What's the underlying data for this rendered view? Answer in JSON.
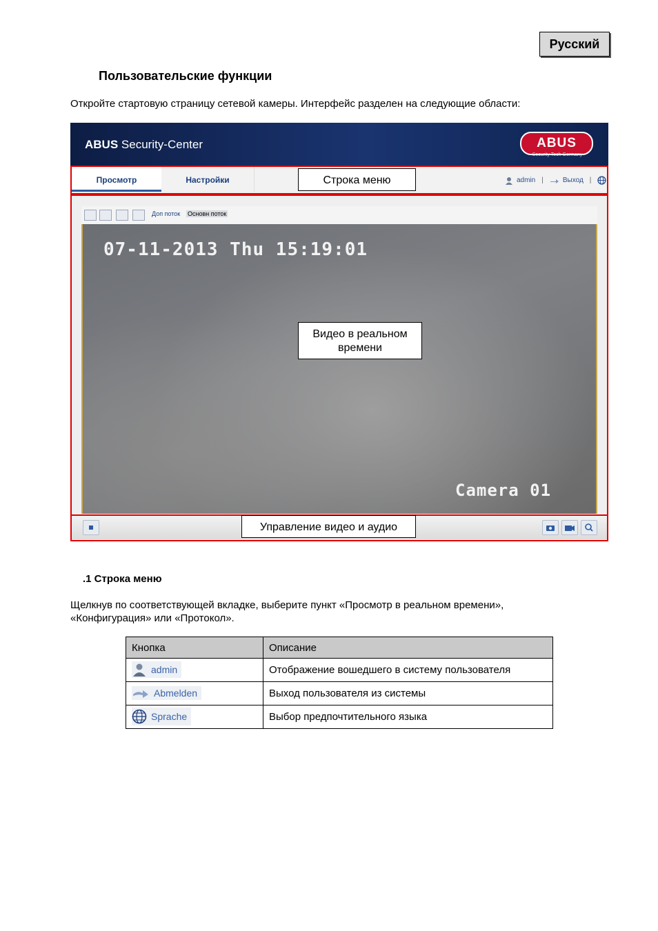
{
  "language_label": "Русский",
  "page_heading": "Пользовательские функции",
  "intro_text": "Откройте стартовую страницу сетевой камеры. Интерфейс разделен на следующие области:",
  "app": {
    "title_bold": "ABUS",
    "title_rest": " Security-Center",
    "logo_text": "ABUS",
    "logo_tagline": "Security Tech Germany",
    "tabs": [
      "Просмотр",
      "Настройки"
    ],
    "user": "admin",
    "logout": "Выход",
    "separator": "|",
    "streams": [
      "Доп поток",
      "Основн поток"
    ],
    "osd_timestamp": "07-11-2013 Thu 15:19:01",
    "osd_camera": "Camera 01"
  },
  "callouts": {
    "menu_bar": "Строка меню",
    "live_video": "Видео в реальном времени",
    "av_control": "Управление видео и аудио"
  },
  "section": {
    "heading": ".1 Строка меню",
    "paragraph": "Щелкнув по соответствующей вкладке, выберите пункт «Просмотр в реальном времени», «Конфигурация» или «Протокол»."
  },
  "table": {
    "headers": [
      "Кнопка",
      "Описание"
    ],
    "rows": [
      {
        "button": "admin",
        "icon": "user-icon",
        "description": "Отображение вошедшего в систему пользователя"
      },
      {
        "button": "Abmelden",
        "icon": "logout-icon",
        "description": "Выход пользователя из системы"
      },
      {
        "button": "Sprache",
        "icon": "globe-icon",
        "description": "Выбор предпочтительного языка"
      }
    ]
  },
  "colors": {
    "annotation_red": "#e00000",
    "header_blue": "#1a3470",
    "abus_red": "#c8102e",
    "link_blue": "#2a4d8c"
  }
}
